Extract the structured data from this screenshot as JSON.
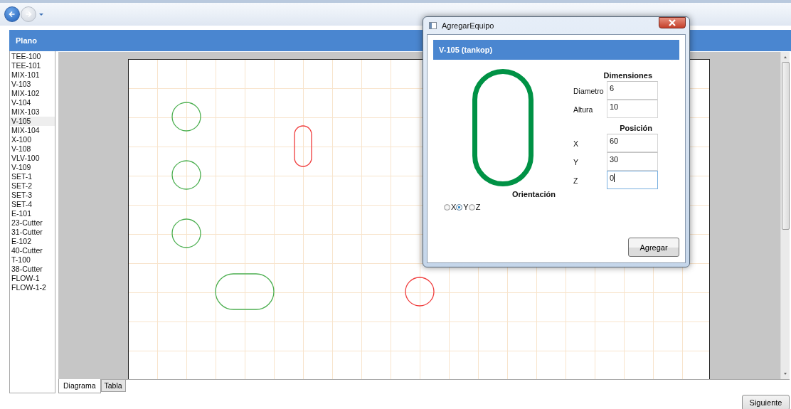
{
  "toolbar": {
    "back": {
      "disabled": false
    },
    "forward": {
      "disabled": true
    }
  },
  "panel": {
    "title": "Plano"
  },
  "equipment_list": [
    {
      "label": "TEE-100",
      "selected": false
    },
    {
      "label": "TEE-101",
      "selected": false
    },
    {
      "label": "MIX-101",
      "selected": false
    },
    {
      "label": "V-103",
      "selected": false
    },
    {
      "label": "MIX-102",
      "selected": false
    },
    {
      "label": "V-104",
      "selected": false
    },
    {
      "label": "MIX-103",
      "selected": false
    },
    {
      "label": "V-105",
      "selected": true
    },
    {
      "label": "MIX-104",
      "selected": false
    },
    {
      "label": "X-100",
      "selected": false
    },
    {
      "label": "V-108",
      "selected": false
    },
    {
      "label": "VLV-100",
      "selected": false
    },
    {
      "label": "V-109",
      "selected": false
    },
    {
      "label": "SET-1",
      "selected": false
    },
    {
      "label": "SET-2",
      "selected": false
    },
    {
      "label": "SET-3",
      "selected": false
    },
    {
      "label": "SET-4",
      "selected": false
    },
    {
      "label": "E-101",
      "selected": false
    },
    {
      "label": "23-Cutter",
      "selected": false
    },
    {
      "label": "31-Cutter",
      "selected": false
    },
    {
      "label": "E-102",
      "selected": false
    },
    {
      "label": "40-Cutter",
      "selected": false
    },
    {
      "label": "T-100",
      "selected": false
    },
    {
      "label": "38-Cutter",
      "selected": false
    },
    {
      "label": "FLOW-1",
      "selected": false
    },
    {
      "label": "FLOW-1-2",
      "selected": false
    }
  ],
  "diagram": {
    "shapes": [
      {
        "kind": "circle",
        "color": "#4caf50"
      },
      {
        "kind": "circle",
        "color": "#4caf50"
      },
      {
        "kind": "circle",
        "color": "#4caf50"
      },
      {
        "kind": "vertical",
        "color": "#f03c3c"
      },
      {
        "kind": "horizontal",
        "color": "#4caf50"
      },
      {
        "kind": "circle",
        "color": "#f03c3c"
      }
    ]
  },
  "tabs": [
    {
      "label": "Diagrama",
      "selected": true
    },
    {
      "label": "Tabla",
      "selected": false
    }
  ],
  "dialog": {
    "title": "AgregarEquipo",
    "header": "V-105 (tankop)",
    "preview": {
      "kind": "vertical",
      "color": "#009245"
    },
    "orientation_label": "Orientación",
    "orientation_options": [
      {
        "label": "X",
        "selected": false
      },
      {
        "label": "Y",
        "selected": true
      },
      {
        "label": "Z",
        "selected": false
      }
    ],
    "sections": [
      {
        "title": "Dimensiones",
        "fields": [
          {
            "label": "Diametro",
            "value": "6",
            "focused": false
          },
          {
            "label": "Altura",
            "value": "10",
            "focused": false
          }
        ]
      },
      {
        "title": "Posición",
        "fields": [
          {
            "label": "X",
            "value": "60",
            "focused": false
          },
          {
            "label": "Y",
            "value": "30",
            "focused": false
          },
          {
            "label": "Z",
            "value": "0",
            "focused": true
          }
        ]
      }
    ],
    "button": "Agregar"
  },
  "next_button": "Siguiente"
}
